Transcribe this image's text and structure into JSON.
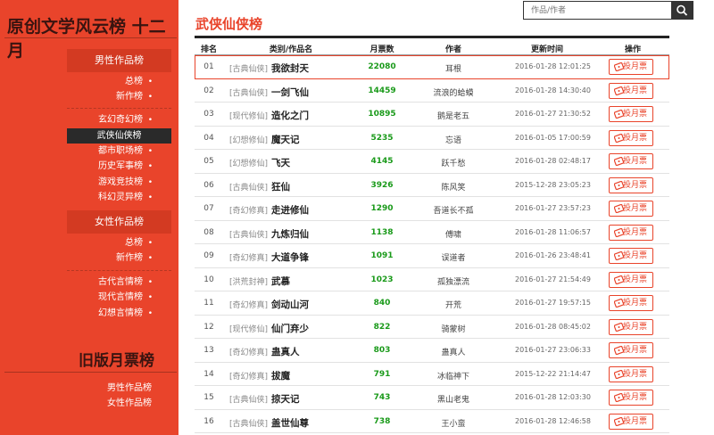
{
  "sidebar": {
    "title": "原创文学风云榜 十二月",
    "male_section": "男性作品榜",
    "male_top": [
      {
        "label": "总榜"
      },
      {
        "label": "新作榜"
      }
    ],
    "male_genres": [
      {
        "label": "玄幻奇幻榜"
      },
      {
        "label": "武侠仙侠榜"
      },
      {
        "label": "都市职场榜"
      },
      {
        "label": "历史军事榜"
      },
      {
        "label": "游戏竞技榜"
      },
      {
        "label": "科幻灵异榜"
      }
    ],
    "female_section": "女性作品榜",
    "female_top": [
      {
        "label": "总榜"
      },
      {
        "label": "新作榜"
      }
    ],
    "female_genres": [
      {
        "label": "古代言情榜"
      },
      {
        "label": "现代言情榜"
      },
      {
        "label": "幻想言情榜"
      }
    ],
    "old_title": "旧版月票榜",
    "old_links": [
      {
        "label": "男性作品榜"
      },
      {
        "label": "女性作品榜"
      }
    ],
    "active_item": "武侠仙侠榜"
  },
  "main": {
    "title": "武侠仙侠榜"
  },
  "search": {
    "placeholder": "作品/作者"
  },
  "table": {
    "headers": {
      "rank": "排名",
      "category": "类别/作品名",
      "votes": "月票数",
      "author": "作者",
      "time": "更新时间",
      "action": "操作"
    },
    "vote_label": "投月票",
    "rows": [
      {
        "rank": "01",
        "category": "[古典仙侠]",
        "book": "我欲封天",
        "votes": "22080",
        "author": "耳根",
        "time": "2016-01-28 12:01:25"
      },
      {
        "rank": "02",
        "category": "[古典仙侠]",
        "book": "一剑飞仙",
        "votes": "14459",
        "author": "流浪的蛤蟆",
        "time": "2016-01-28 14:30:40"
      },
      {
        "rank": "03",
        "category": "[现代修仙]",
        "book": "造化之门",
        "votes": "10895",
        "author": "鹅是老五",
        "time": "2016-01-27 21:30:52"
      },
      {
        "rank": "04",
        "category": "[幻想修仙]",
        "book": "魔天记",
        "votes": "5235",
        "author": "忘语",
        "time": "2016-01-05 17:00:59"
      },
      {
        "rank": "05",
        "category": "[幻想修仙]",
        "book": "飞天",
        "votes": "4145",
        "author": "跃千愁",
        "time": "2016-01-28 02:48:17"
      },
      {
        "rank": "06",
        "category": "[古典仙侠]",
        "book": "狂仙",
        "votes": "3926",
        "author": "陈风笑",
        "time": "2015-12-28 23:05:23"
      },
      {
        "rank": "07",
        "category": "[奇幻修真]",
        "book": "走进修仙",
        "votes": "1290",
        "author": "吾道长不孤",
        "time": "2016-01-27 23:57:23"
      },
      {
        "rank": "08",
        "category": "[古典仙侠]",
        "book": "九炼归仙",
        "votes": "1138",
        "author": "傅啸",
        "time": "2016-01-28 11:06:57"
      },
      {
        "rank": "09",
        "category": "[奇幻修真]",
        "book": "大道争锋",
        "votes": "1091",
        "author": "误道者",
        "time": "2016-01-26 23:48:41"
      },
      {
        "rank": "10",
        "category": "[洪荒封神]",
        "book": "武慕",
        "votes": "1023",
        "author": "孤独漂流",
        "time": "2016-01-27 21:54:49"
      },
      {
        "rank": "11",
        "category": "[奇幻修真]",
        "book": "剑动山河",
        "votes": "840",
        "author": "开荒",
        "time": "2016-01-27 19:57:15"
      },
      {
        "rank": "12",
        "category": "[现代修仙]",
        "book": "仙门弃少",
        "votes": "822",
        "author": "骑蒙树",
        "time": "2016-01-28 08:45:02"
      },
      {
        "rank": "13",
        "category": "[奇幻修真]",
        "book": "蛊真人",
        "votes": "803",
        "author": "蛊真人",
        "time": "2016-01-27 23:06:33"
      },
      {
        "rank": "14",
        "category": "[奇幻修真]",
        "book": "拔魔",
        "votes": "791",
        "author": "冰临神下",
        "time": "2015-12-22 21:14:47"
      },
      {
        "rank": "15",
        "category": "[古典仙侠]",
        "book": "掠天记",
        "votes": "743",
        "author": "黑山老鬼",
        "time": "2016-01-28 12:03:30"
      },
      {
        "rank": "16",
        "category": "[古典仙侠]",
        "book": "盖世仙尊",
        "votes": "738",
        "author": "王小蛮",
        "time": "2016-01-28 12:46:58"
      }
    ]
  },
  "colors": {
    "accent": "#e9442b",
    "sidebar": "#e9442b",
    "active_item_bg": "#2a2a2a",
    "votes": "#1a9a1a"
  },
  "icons": {
    "search": "search-icon",
    "vote": "ticket-icon"
  }
}
